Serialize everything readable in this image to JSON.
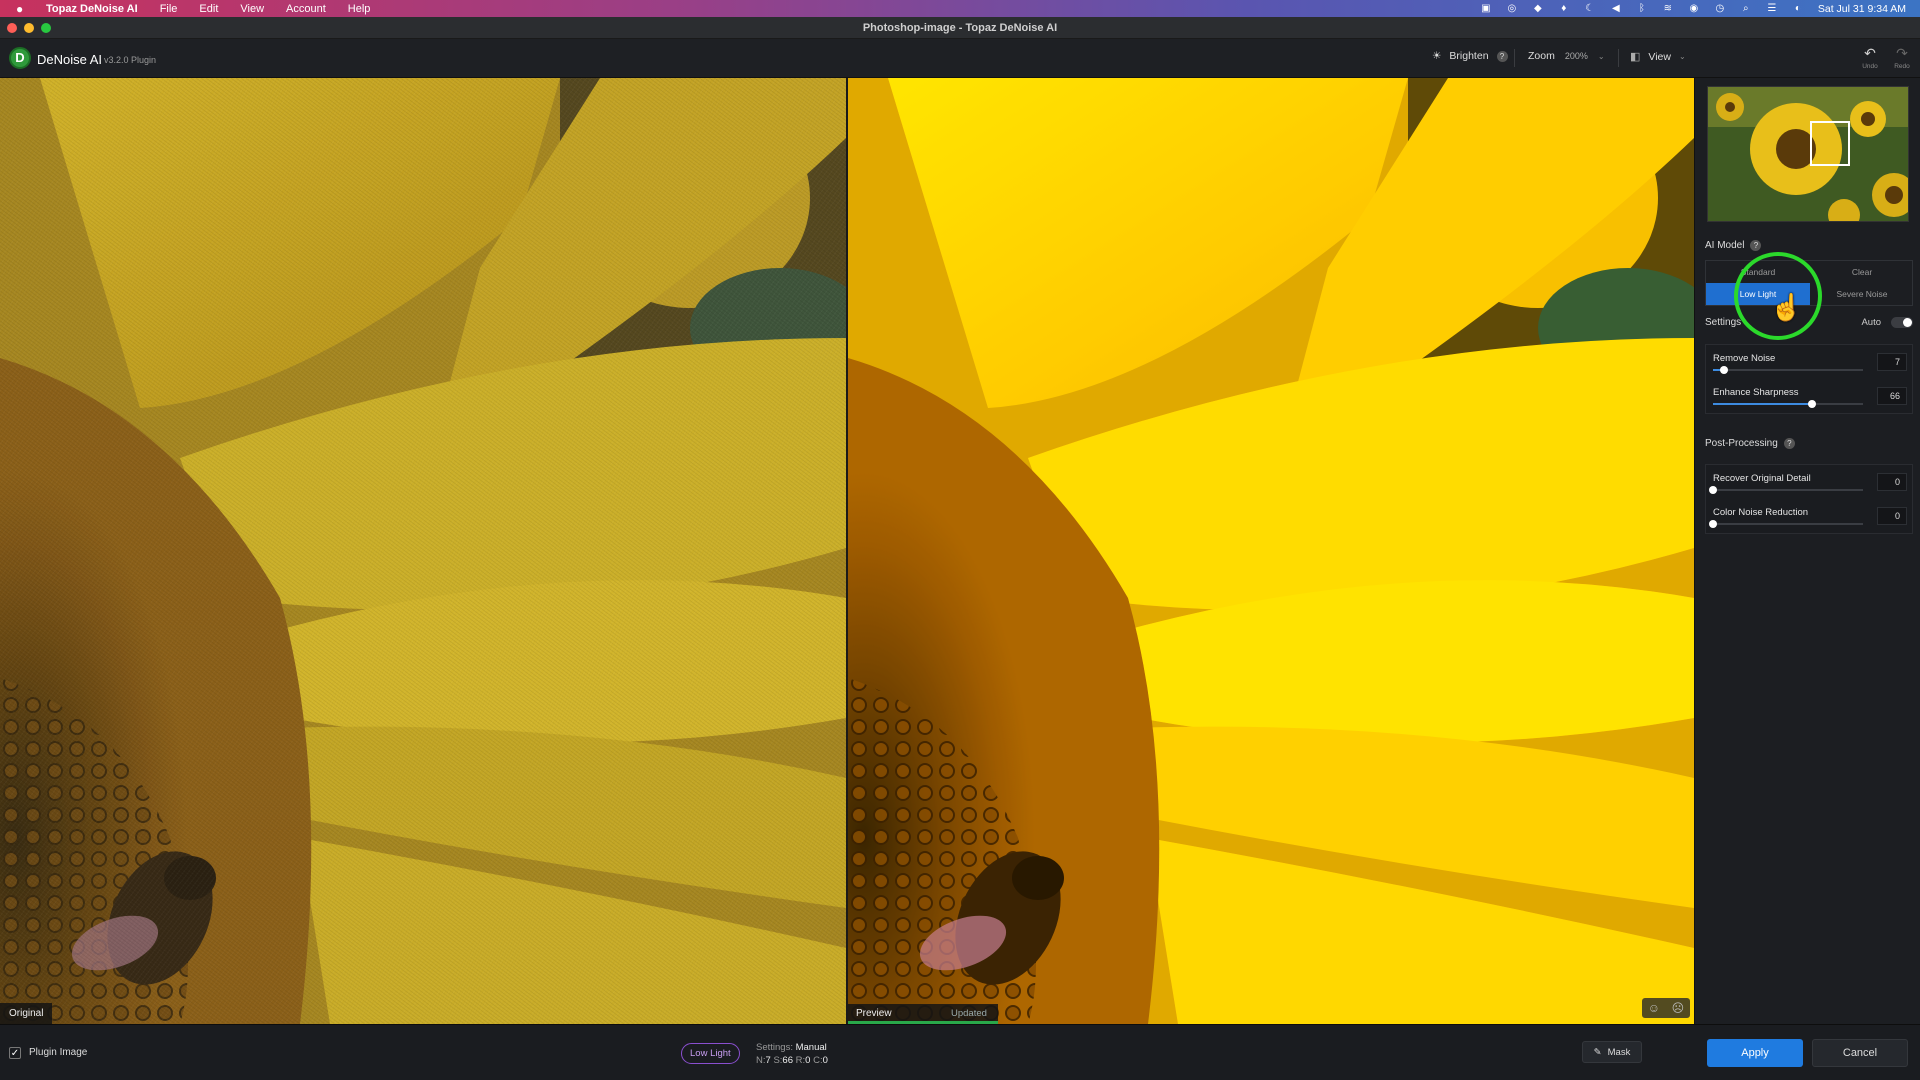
{
  "menubar": {
    "app": "Topaz DeNoise AI",
    "items": [
      "File",
      "Edit",
      "View",
      "Account",
      "Help"
    ],
    "clock": "Sat Jul 31  9:34 AM"
  },
  "window": {
    "title": "Photoshop-image - Topaz DeNoise AI"
  },
  "toolbar": {
    "logo_letter": "D",
    "app_name": "DeNoise AI",
    "version": "v3.2.0 Plugin",
    "brighten": "Brighten",
    "zoom_label": "Zoom",
    "zoom_value": "200%",
    "view_label": "View",
    "undo": "Undo",
    "redo": "Redo"
  },
  "canvas": {
    "left_label": "Original",
    "preview_label": "Preview",
    "preview_status": "Updated"
  },
  "panel": {
    "ai_model_title": "AI Model",
    "models": [
      {
        "label": "Standard",
        "selected": false
      },
      {
        "label": "Clear",
        "selected": false
      },
      {
        "label": "Low Light",
        "selected": true
      },
      {
        "label": "Severe Noise",
        "selected": false
      }
    ],
    "settings_title": "Settings",
    "auto_label": "Auto",
    "auto_on": false,
    "sliders": [
      {
        "label": "Remove Noise",
        "value": "7",
        "fraction": 0.07
      },
      {
        "label": "Enhance Sharpness",
        "value": "66",
        "fraction": 0.66
      }
    ],
    "post_title": "Post-Processing",
    "post_sliders": [
      {
        "label": "Recover Original Detail",
        "value": "0",
        "fraction": 0
      },
      {
        "label": "Color Noise Reduction",
        "value": "0",
        "fraction": 0
      }
    ]
  },
  "bottom": {
    "plugin_image": "Plugin Image",
    "model_pill": "Low Light",
    "settings_prefix": "Settings:",
    "settings_value": "Manual",
    "n_label": "N:",
    "n_value": "7",
    "s_label": "S:",
    "s_value": "66",
    "r_label": "R:",
    "r_value": "0",
    "c_label": "C:",
    "c_value": "0",
    "mask": "Mask",
    "apply": "Apply",
    "cancel": "Cancel"
  },
  "colors": {
    "accent": "#1f7be0",
    "preview_bar": "#29a84a",
    "highlight_ring": "#2bd92b",
    "pill_border": "#8a4fcf"
  }
}
